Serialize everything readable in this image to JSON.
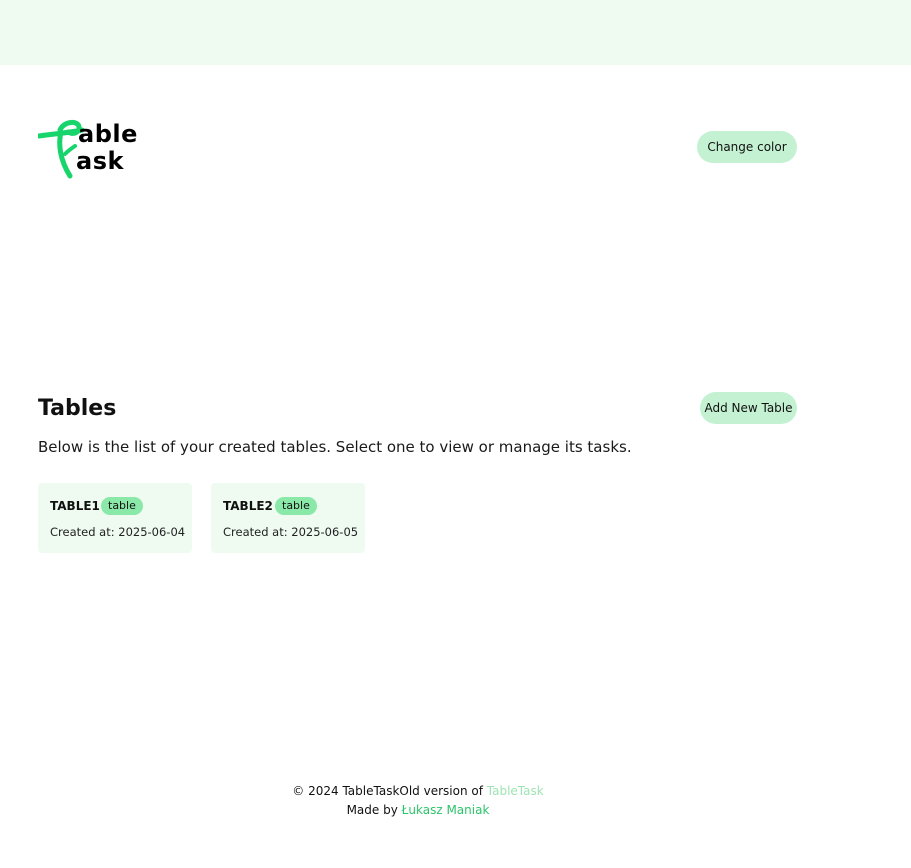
{
  "header": {
    "logo": {
      "line1": "able",
      "line2": "ask",
      "accent_color": "#17d46b"
    },
    "change_color_label": "Change color"
  },
  "tables_section": {
    "title": "Tables",
    "description": "Below is the list of your created tables. Select one to view or manage its tasks.",
    "add_button_label": "Add New Table",
    "cards": [
      {
        "name": "TABLE1",
        "badge": "table",
        "created": "Created at: 2025-06-04"
      },
      {
        "name": "TABLE2",
        "badge": "table",
        "created": "Created at: 2025-06-05"
      }
    ]
  },
  "footer": {
    "copyright": "© 2024 TableTask",
    "old_version_prefix": "Old version of ",
    "old_version_link": "TableTask",
    "made_by_prefix": "Made by ",
    "author": "Łukasz Maniak"
  },
  "colors": {
    "topbar_bg": "#effbf1",
    "button_bg": "#c3f1d2",
    "card_bg": "#effbf1",
    "badge_bg": "#8ae8a8",
    "link_green": "#2cc46a",
    "link_faint": "#9ee3b4"
  }
}
